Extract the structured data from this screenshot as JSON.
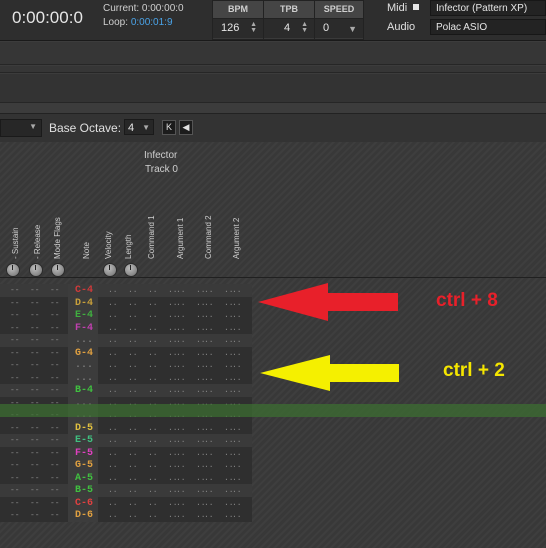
{
  "transport": {
    "time": "0:00:00:0",
    "current_label": "Current: 0:00:00:0",
    "loop_label": "Loop: ",
    "loop_value": "0:00:01:9"
  },
  "spinners": {
    "bpm": {
      "label": "BPM",
      "value": "126"
    },
    "tpb": {
      "label": "TPB",
      "value": "4"
    },
    "speed": {
      "label": "SPEED",
      "value": "0"
    }
  },
  "devices": {
    "midi_label": "Midi",
    "midi_device": "Infector (Pattern XP)",
    "audio_label": "Audio",
    "audio_device": "Polac ASIO"
  },
  "toolbar": {
    "base_octave_label": "Base Octave:",
    "base_octave_value": "4",
    "k_button": "K"
  },
  "track": {
    "name": "Infector",
    "number": "Track 0"
  },
  "columns": [
    "- Sustain",
    "- Release",
    "Mode Flags",
    "Note",
    "Velocity",
    "Length",
    "Command 1",
    "Argument 1",
    "Command 2",
    "Argument 2"
  ],
  "notes": [
    {
      "text": "C-4",
      "color": "#d03a3a"
    },
    {
      "text": "D-4",
      "color": "#c9a03a"
    },
    {
      "text": "E-4",
      "color": "#40b040"
    },
    {
      "text": "F-4",
      "color": "#c040b0"
    },
    {
      "text": "",
      "color": ""
    },
    {
      "text": "G-4",
      "color": "#e0a040"
    },
    {
      "text": "",
      "color": ""
    },
    {
      "text": "",
      "color": ""
    },
    {
      "text": "B-4",
      "color": "#40c040"
    },
    {
      "text": "",
      "color": ""
    },
    {
      "text": "",
      "color": ""
    },
    {
      "text": "D-5",
      "color": "#e0c040"
    },
    {
      "text": "E-5",
      "color": "#40c080"
    },
    {
      "text": "F-5",
      "color": "#e040c0"
    },
    {
      "text": "G-5",
      "color": "#e0a040"
    },
    {
      "text": "A-5",
      "color": "#40c040"
    },
    {
      "text": "B-5",
      "color": "#40c040"
    },
    {
      "text": "C-6",
      "color": "#e04040"
    },
    {
      "text": "D-6",
      "color": "#e0a040"
    }
  ],
  "annotations": {
    "red": {
      "text": "ctrl + 8",
      "color": "#e8202a"
    },
    "yellow": {
      "text": "ctrl + 2",
      "color": "#f5e600"
    }
  }
}
